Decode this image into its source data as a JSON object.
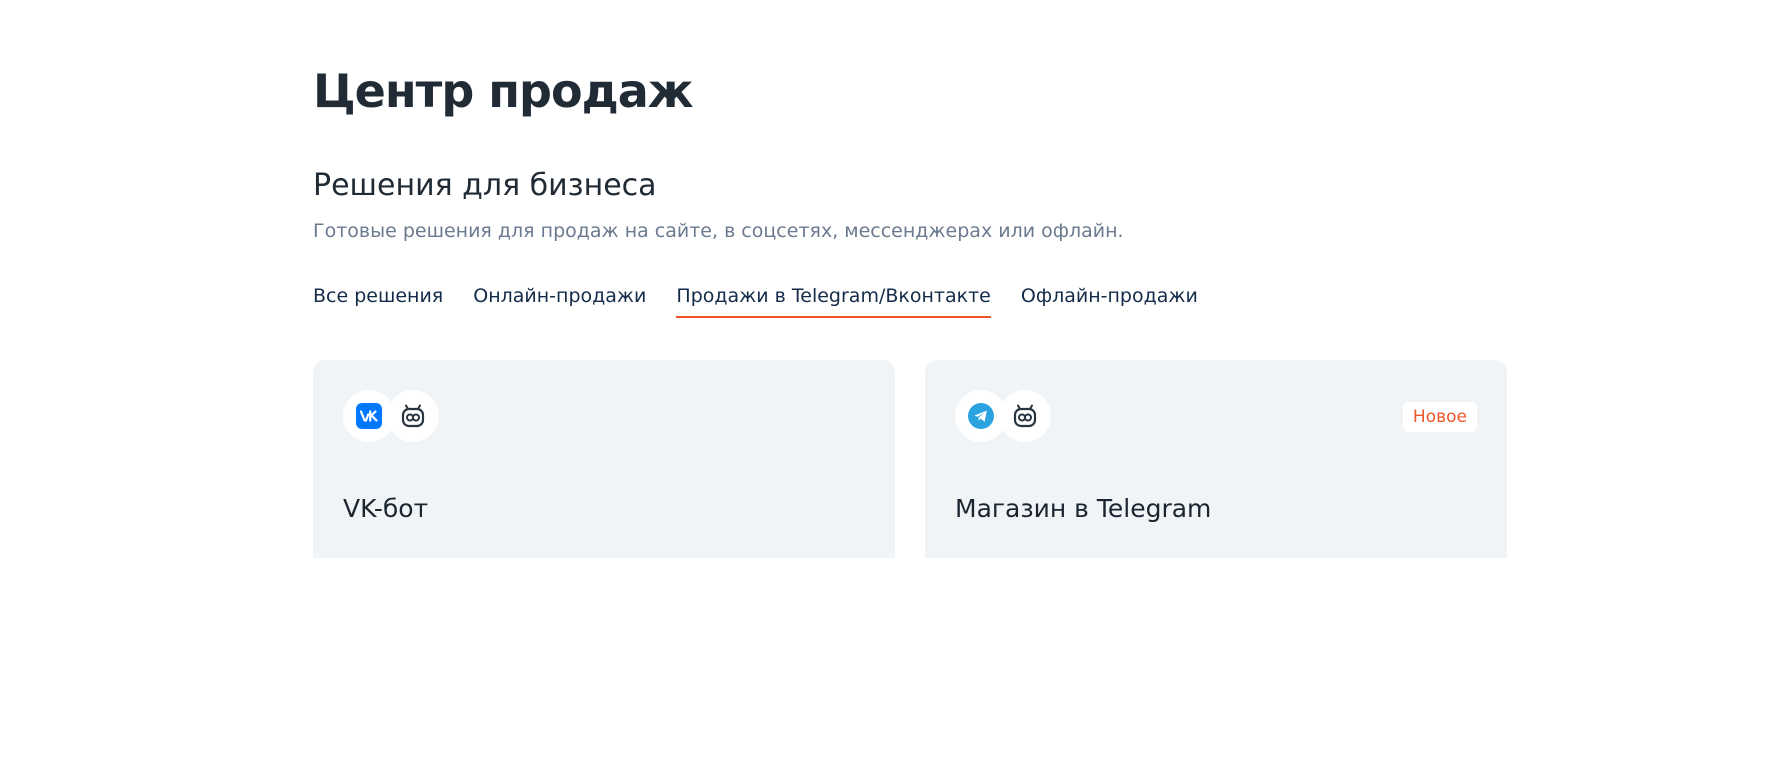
{
  "header": {
    "title": "Центр продаж"
  },
  "section": {
    "title": "Решения для бизнеса",
    "subtitle": "Готовые решения для продаж на сайте, в соцсетях, мессенджерах или офлайн."
  },
  "tabs": [
    {
      "label": "Все решения",
      "active": false
    },
    {
      "label": "Онлайн-продажи",
      "active": false
    },
    {
      "label": "Продажи в Telegram/Вконтакте",
      "active": true
    },
    {
      "label": "Офлайн-продажи",
      "active": false
    }
  ],
  "cards": [
    {
      "title": "VK-бот",
      "icons": [
        "vk-icon",
        "bot-icon"
      ],
      "badge": ""
    },
    {
      "title": "Магазин в Telegram",
      "icons": [
        "telegram-icon",
        "bot-icon"
      ],
      "badge": "Новое"
    }
  ],
  "colors": {
    "accent": "#f0552a",
    "card_background": "#f1f4f7",
    "vk_brand": "#0077ff",
    "telegram_brand": "#2aa3e0"
  }
}
